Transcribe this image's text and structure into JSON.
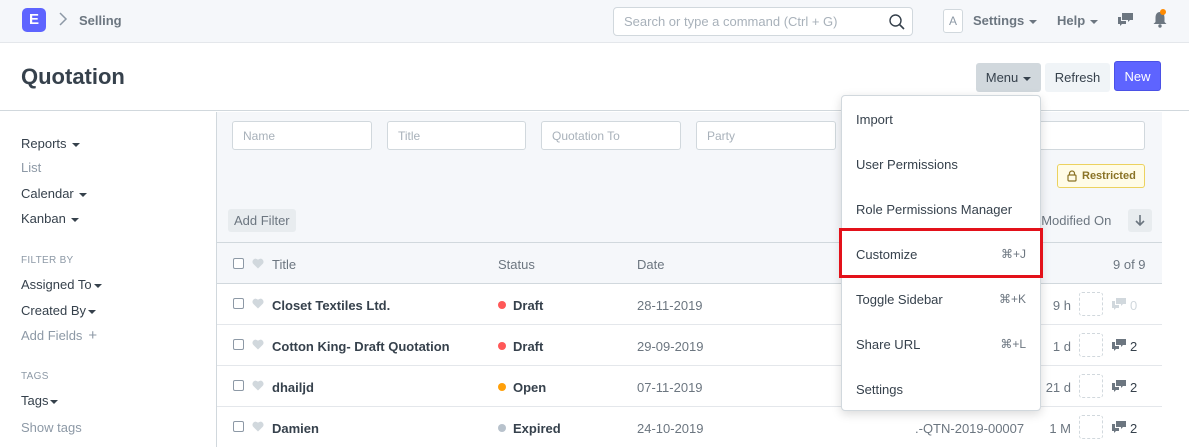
{
  "navbar": {
    "logo_letter": "E",
    "breadcrumb": "Selling",
    "search_placeholder": "Search or type a command (Ctrl + G)",
    "avatar_letter": "A",
    "settings_label": "Settings",
    "help_label": "Help"
  },
  "page": {
    "title": "Quotation",
    "menu_label": "Menu",
    "refresh_label": "Refresh",
    "new_label": "New"
  },
  "sidebar": {
    "views": [
      {
        "label": "Reports",
        "dropdown": true
      },
      {
        "label": "List",
        "dropdown": false
      },
      {
        "label": "Calendar",
        "dropdown": true
      },
      {
        "label": "Kanban",
        "dropdown": true
      }
    ],
    "filter_by_heading": "FILTER BY",
    "filters": [
      {
        "label": "Assigned To"
      },
      {
        "label": "Created By"
      }
    ],
    "add_fields_label": "Add Fields",
    "tags_heading": "TAGS",
    "tags_label": "Tags",
    "show_tags_label": "Show tags"
  },
  "filters": {
    "placeholders": [
      "Name",
      "Title",
      "Quotation To",
      "Party"
    ],
    "restricted_label": "Restricted",
    "add_filter_label": "Add Filter",
    "sort_label": "t Modified On"
  },
  "list": {
    "headers": {
      "title": "Title",
      "status": "Status",
      "date": "Date",
      "count": "9 of 9"
    },
    "rows": [
      {
        "title": "Closet Textiles Ltd.",
        "status": "Draft",
        "status_color": "#ff5858",
        "date": "28-11-2019",
        "name": "",
        "ago": "9 h",
        "comments": "0"
      },
      {
        "title": "Cotton King- Draft Quotation",
        "status": "Draft",
        "status_color": "#ff5858",
        "date": "29-09-2019",
        "name": "",
        "ago": "1 d",
        "comments": "2"
      },
      {
        "title": "dhailjd",
        "status": "Open",
        "status_color": "#ffa00a",
        "date": "07-11-2019",
        "name": "",
        "ago": "21 d",
        "comments": "2"
      },
      {
        "title": "Damien",
        "status": "Expired",
        "status_color": "#b8c2cc",
        "date": "24-10-2019",
        "name": ".-QTN-2019-00007",
        "ago": "1 M",
        "comments": "2"
      }
    ]
  },
  "menu_dropdown": {
    "items": [
      {
        "label": "Import",
        "shortcut": ""
      },
      {
        "label": "User Permissions",
        "shortcut": ""
      },
      {
        "label": "Role Permissions Manager",
        "shortcut": ""
      },
      {
        "label": "Customize",
        "shortcut": "⌘+J",
        "highlighted": true
      },
      {
        "label": "Toggle Sidebar",
        "shortcut": "⌘+K"
      },
      {
        "label": "Share URL",
        "shortcut": "⌘+L"
      },
      {
        "label": "Settings",
        "shortcut": ""
      }
    ]
  },
  "colors": {
    "accent": "#5e64ff",
    "highlight_box": "#e3111a"
  }
}
